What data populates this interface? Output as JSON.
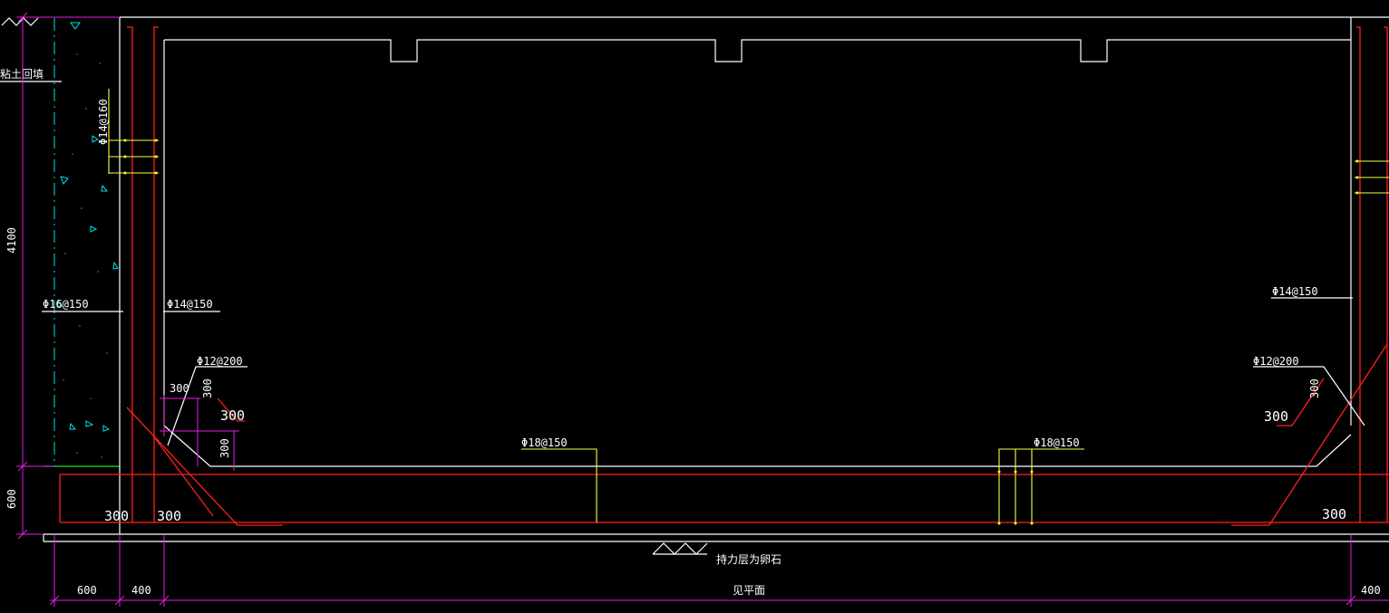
{
  "labels": {
    "backfill": "粘土回填",
    "rebar_left_vertical": "Φ14@160",
    "rebar_outer_left": "Φ16@150",
    "rebar_inner_left": "Φ14@150",
    "rebar_inner_right": "Φ14@150",
    "rebar_haunch_left": "Φ12@200",
    "rebar_haunch_right": "Φ12@200",
    "rebar_floor_left": "Φ18@150",
    "rebar_floor_right": "Φ18@150",
    "bearing_layer": "持力层为卵石",
    "see_plan": "见平面"
  },
  "dimensions": {
    "height_wall": "4100",
    "height_base": "600",
    "width_footing": "600",
    "width_wall_left": "400",
    "width_wall_right": "400",
    "haunch_w": "300",
    "haunch_h": "300",
    "haunch_left_side": "300",
    "haunch_left_bottom": "300",
    "base_left_300a": "300",
    "base_left_300b": "300",
    "haunch_right_side": "300",
    "haunch_right_bottom": "300",
    "base_right_300": "300"
  },
  "colors": {
    "background": "#000000",
    "outline": "#ffffff",
    "rebar": "#ff2020",
    "dimension": "#e020e0",
    "leader": "#ffff40",
    "soil": "#00e0e0",
    "grade_line": "#20e020"
  }
}
